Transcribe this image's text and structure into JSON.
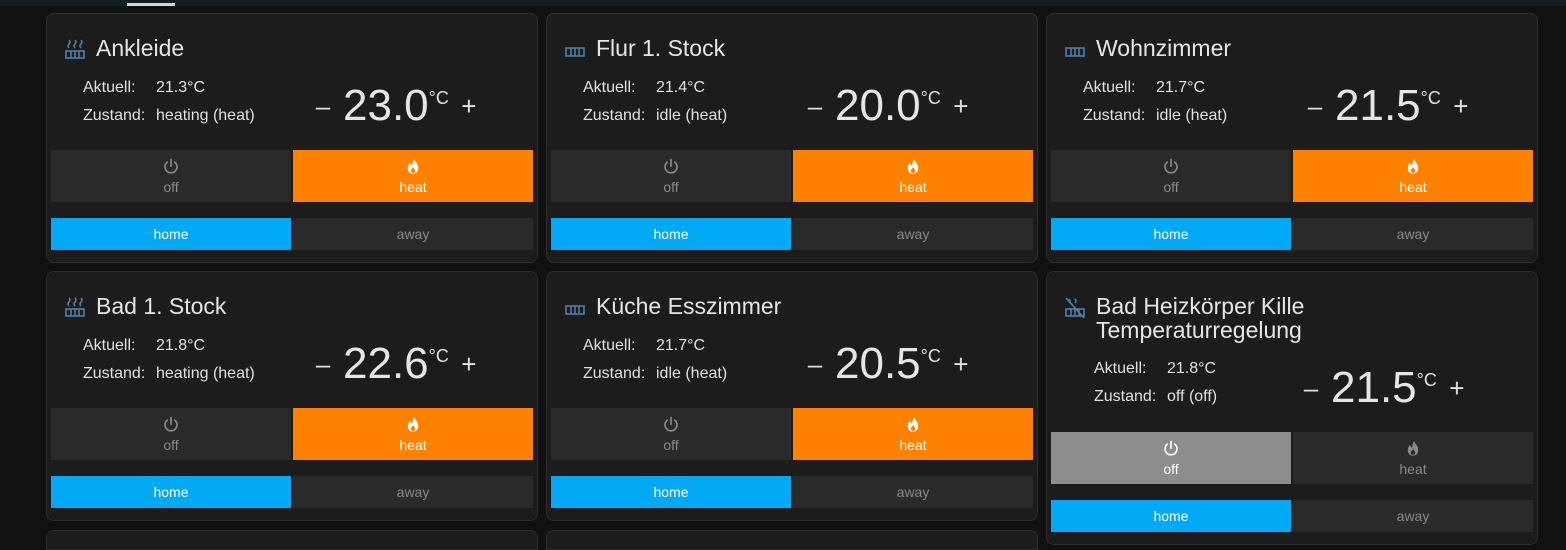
{
  "colors": {
    "heat": "#ff8100",
    "home": "#03a9f4",
    "off_active": "#8d8d8d",
    "icon": "#4f7fa8"
  },
  "cards": [
    {
      "name": "Ankleide",
      "icon": "radiator-heating-icon",
      "current_label": "Aktuell:",
      "current": "21.3°C",
      "state_label": "Zustand:",
      "state": "heating (heat)",
      "minus": "–",
      "plus": "+",
      "target": "23.0",
      "unit": "°C",
      "mode_off": "off",
      "mode_heat": "heat",
      "active_mode": "heat",
      "preset_home": "home",
      "preset_away": "away",
      "active_preset": "home"
    },
    {
      "name": "Flur 1. Stock",
      "icon": "radiator-icon",
      "current_label": "Aktuell:",
      "current": "21.4°C",
      "state_label": "Zustand:",
      "state": "idle (heat)",
      "minus": "–",
      "plus": "+",
      "target": "20.0",
      "unit": "°C",
      "mode_off": "off",
      "mode_heat": "heat",
      "active_mode": "heat",
      "preset_home": "home",
      "preset_away": "away",
      "active_preset": "home"
    },
    {
      "name": "Wohnzimmer",
      "icon": "radiator-icon",
      "current_label": "Aktuell:",
      "current": "21.7°C",
      "state_label": "Zustand:",
      "state": "idle (heat)",
      "minus": "–",
      "plus": "+",
      "target": "21.5",
      "unit": "°C",
      "mode_off": "off",
      "mode_heat": "heat",
      "active_mode": "heat",
      "preset_home": "home",
      "preset_away": "away",
      "active_preset": "home"
    },
    {
      "name": "Bad 1. Stock",
      "icon": "radiator-heating-icon",
      "current_label": "Aktuell:",
      "current": "21.8°C",
      "state_label": "Zustand:",
      "state": "heating (heat)",
      "minus": "–",
      "plus": "+",
      "target": "22.6",
      "unit": "°C",
      "mode_off": "off",
      "mode_heat": "heat",
      "active_mode": "heat",
      "preset_home": "home",
      "preset_away": "away",
      "active_preset": "home"
    },
    {
      "name": "Küche Esszimmer",
      "icon": "radiator-icon",
      "current_label": "Aktuell:",
      "current": "21.7°C",
      "state_label": "Zustand:",
      "state": "idle (heat)",
      "minus": "–",
      "plus": "+",
      "target": "20.5",
      "unit": "°C",
      "mode_off": "off",
      "mode_heat": "heat",
      "active_mode": "heat",
      "preset_home": "home",
      "preset_away": "away",
      "active_preset": "home"
    },
    {
      "name_line1": "Bad Heizkörper Kille",
      "name_line2": "Temperaturregelung",
      "icon": "radiator-off-icon",
      "current_label": "Aktuell:",
      "current": "21.8°C",
      "state_label": "Zustand:",
      "state": "off (off)",
      "minus": "–",
      "plus": "+",
      "target": "21.5",
      "unit": "°C",
      "mode_off": "off",
      "mode_heat": "heat",
      "active_mode": "off",
      "preset_home": "home",
      "preset_away": "away",
      "active_preset": "home"
    }
  ]
}
